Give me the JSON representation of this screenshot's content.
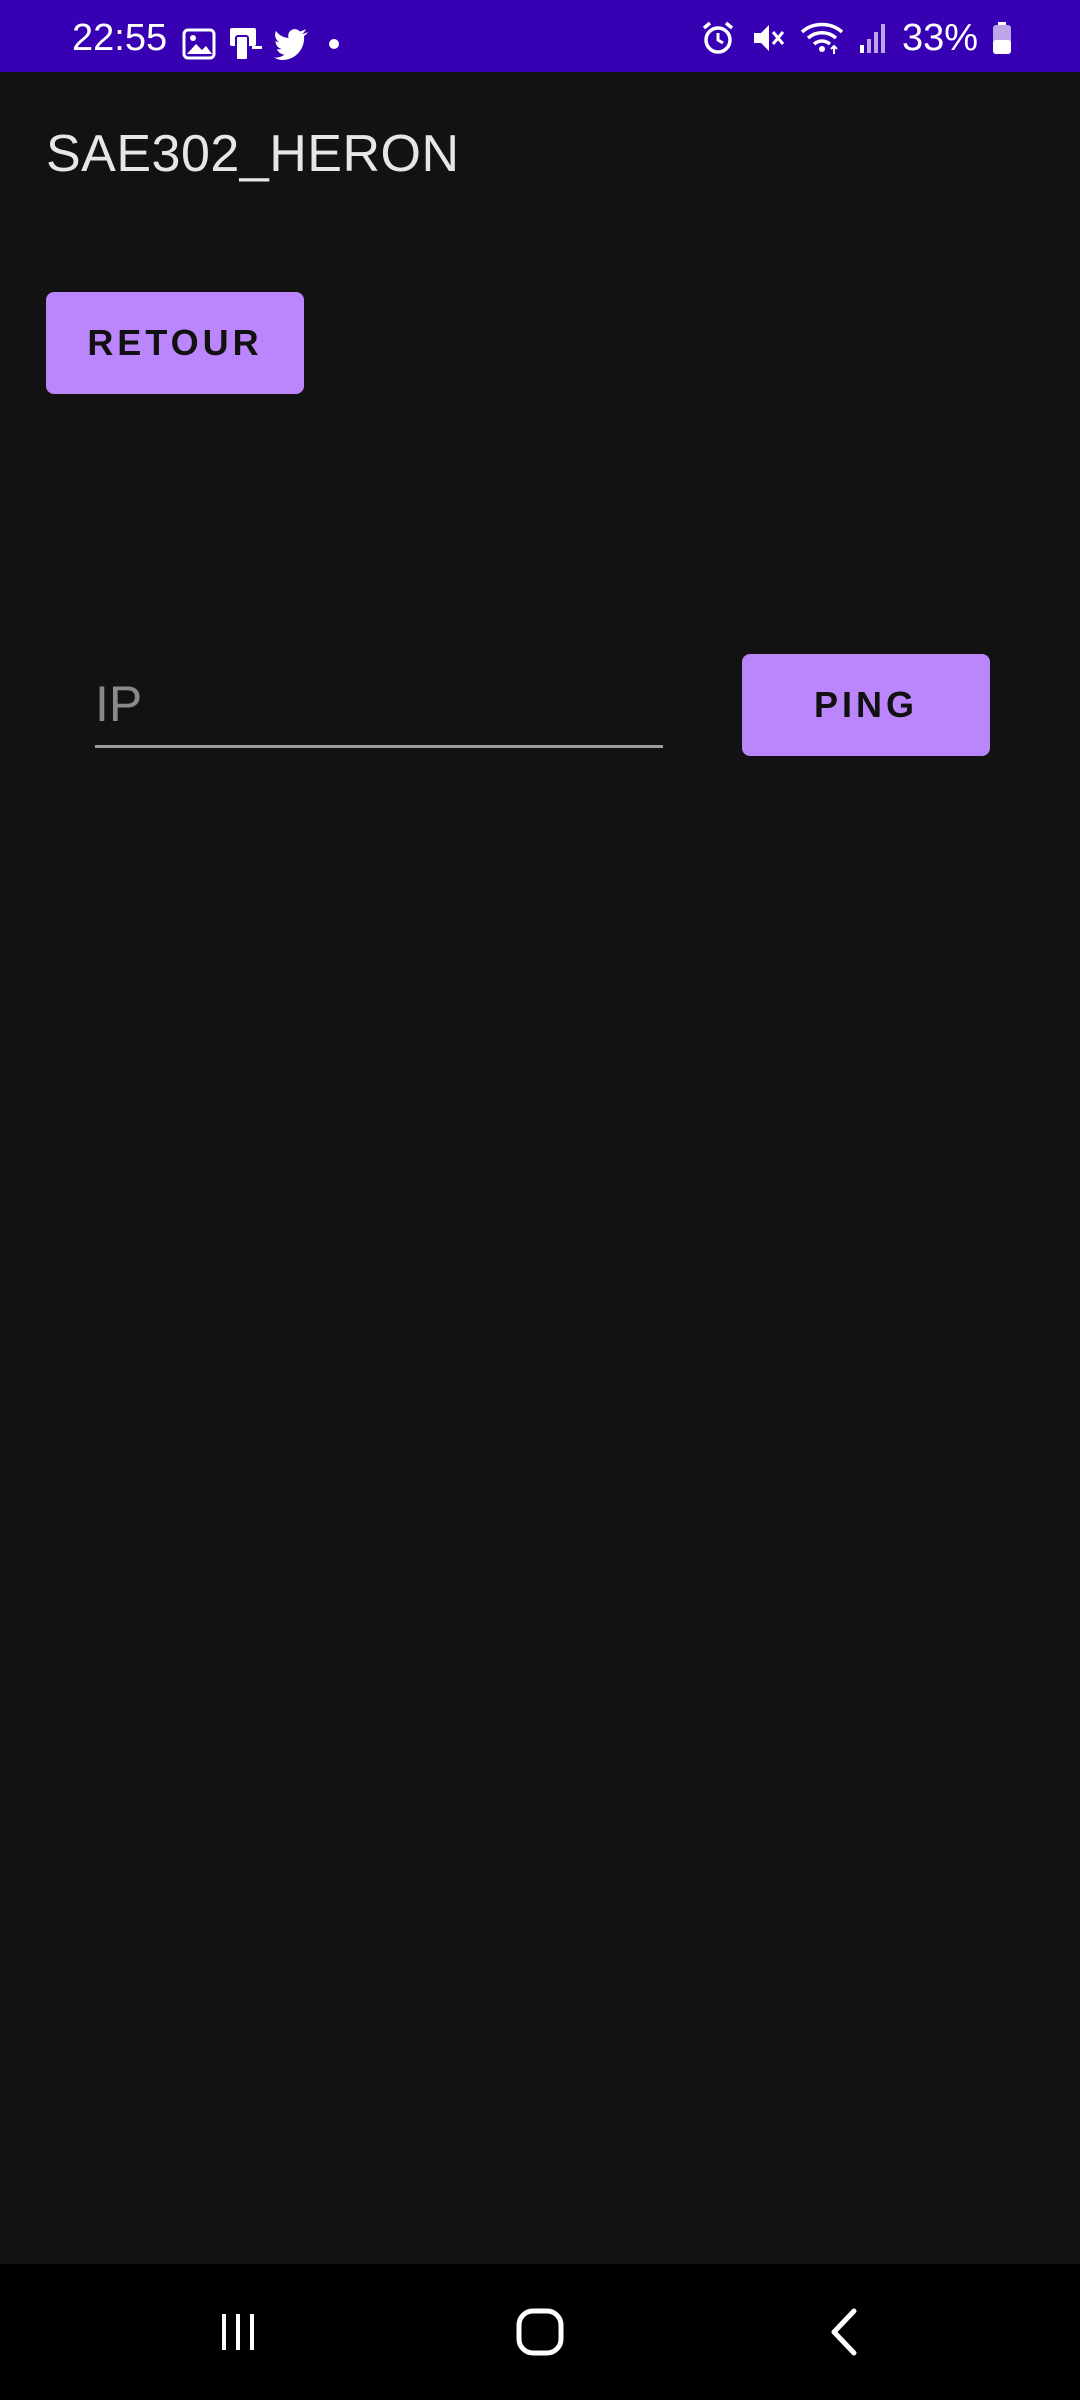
{
  "status_bar": {
    "time": "22:55",
    "battery_percent": "33%",
    "left_icons": [
      "gallery-icon",
      "device-icon",
      "twitter-icon",
      "dot-icon"
    ],
    "right_icons": [
      "alarm-icon",
      "mute-icon",
      "wifi-icon",
      "signal-icon",
      "battery-icon"
    ],
    "background_color": "#3700b3"
  },
  "app_bar": {
    "title": "SAE302_HERON"
  },
  "buttons": {
    "retour_label": "RETOUR",
    "ping_label": "PING",
    "color": "#bb86fc"
  },
  "ip_input": {
    "placeholder": "IP",
    "value": ""
  },
  "nav_bar": {
    "items": [
      "recents-icon",
      "home-icon",
      "back-icon"
    ]
  },
  "theme": {
    "background": "#121212"
  }
}
